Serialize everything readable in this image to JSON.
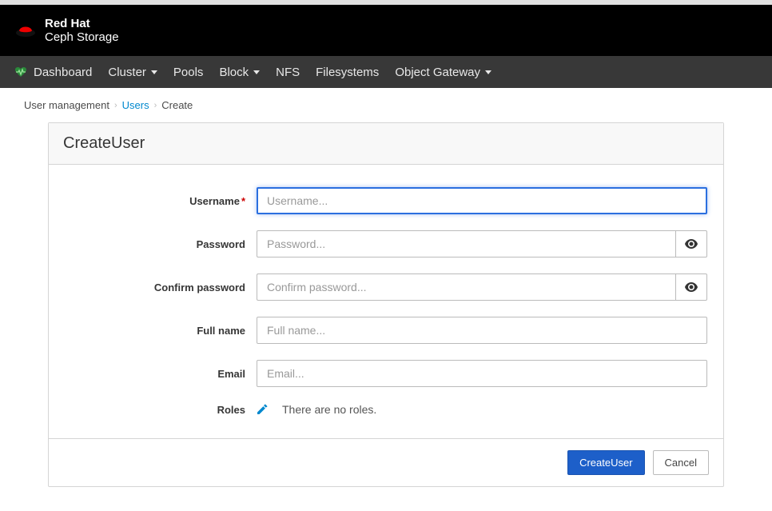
{
  "brand": {
    "top": "Red Hat",
    "bottom": "Ceph Storage"
  },
  "nav": {
    "dashboard": "Dashboard",
    "cluster": "Cluster",
    "pools": "Pools",
    "block": "Block",
    "nfs": "NFS",
    "filesystems": "Filesystems",
    "object_gateway": "Object Gateway"
  },
  "breadcrumb": {
    "item0": "User management",
    "item1": "Users",
    "item2": "Create"
  },
  "panel": {
    "title": "CreateUser"
  },
  "form": {
    "username": {
      "label": "Username",
      "placeholder": "Username...",
      "value": ""
    },
    "password": {
      "label": "Password",
      "placeholder": "Password...",
      "value": ""
    },
    "confirm_password": {
      "label": "Confirm password",
      "placeholder": "Confirm password...",
      "value": ""
    },
    "full_name": {
      "label": "Full name",
      "placeholder": "Full name...",
      "value": ""
    },
    "email": {
      "label": "Email",
      "placeholder": "Email...",
      "value": ""
    },
    "roles": {
      "label": "Roles",
      "empty_text": "There are no roles."
    }
  },
  "buttons": {
    "submit": "CreateUser",
    "cancel": "Cancel"
  }
}
